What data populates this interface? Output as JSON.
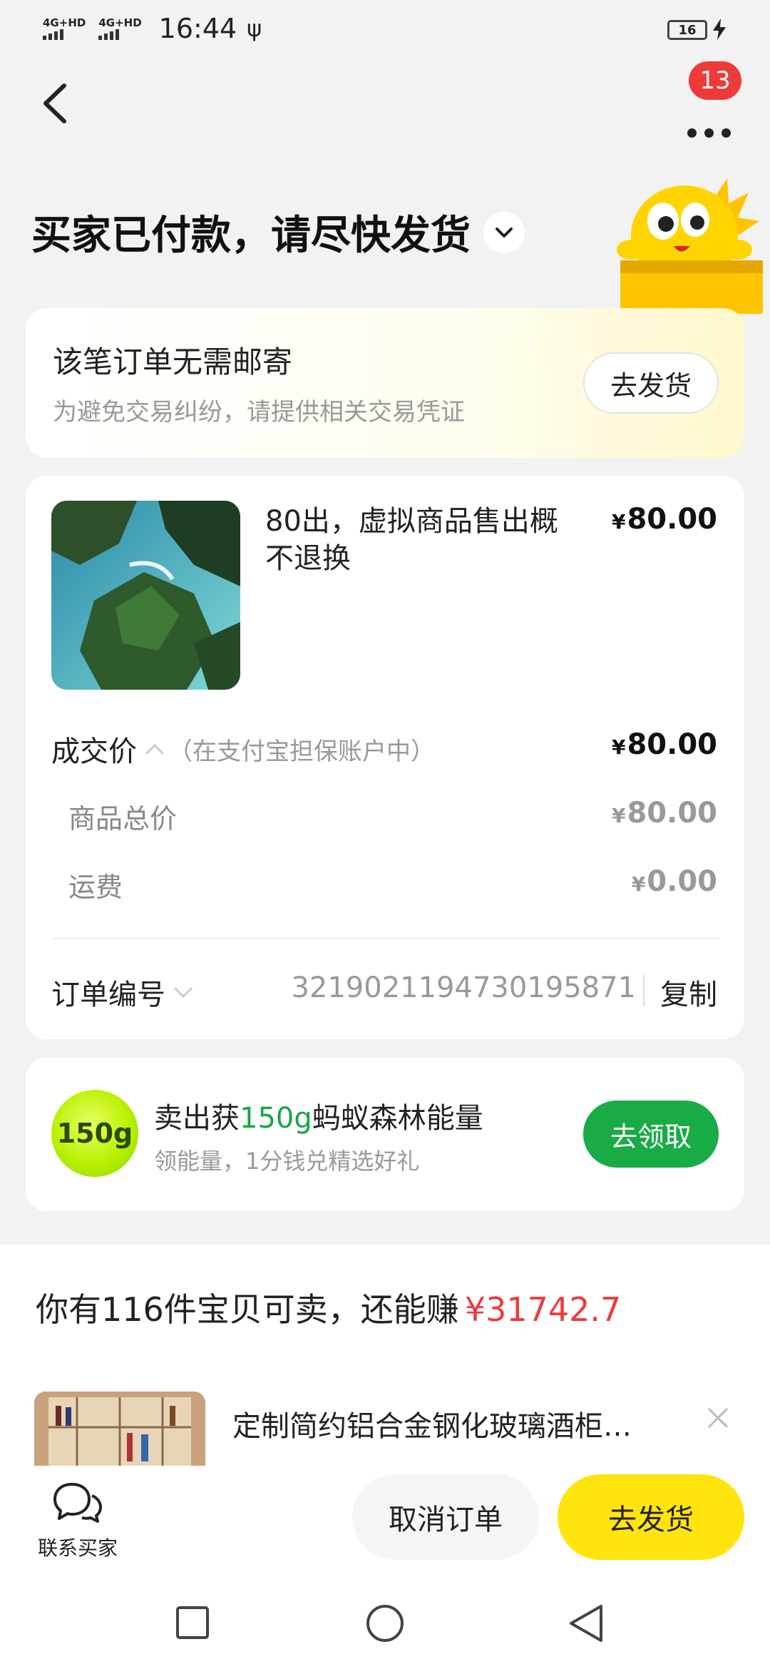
{
  "status_bar": {
    "signal1": "4G+HD",
    "signal2": "4G+HD",
    "time": "16:44",
    "battery": "16"
  },
  "nav": {
    "badge_count": "13"
  },
  "header": {
    "title": "买家已付款，请尽快发货"
  },
  "shipping_notice": {
    "title": "该笔订单无需邮寄",
    "subtitle": "为避免交易纠纷，请提供相关交易凭证",
    "button": "去发货"
  },
  "order": {
    "product_title": "80出，虚拟商品售出概不退换",
    "product_price_symbol": "¥",
    "product_price": "80.00",
    "deal_price_label": "成交价",
    "deal_price_note": "（在支付宝担保账户中）",
    "deal_price": "80.00",
    "goods_total_label": "商品总价",
    "goods_total": "80.00",
    "shipping_label": "运费",
    "shipping": "0.00",
    "order_no_label": "订单编号",
    "order_no": "3219021194730195871",
    "copy_label": "复制"
  },
  "energy": {
    "badge": "150g",
    "title_pre": "卖出获",
    "title_highlight": "150g",
    "title_post": "蚂蚁森林能量",
    "subtitle": "领能量，1分钱兑精选好礼",
    "button": "去领取"
  },
  "promo": {
    "text": "你有116件宝贝可卖，还能赚",
    "amount": "¥31742.7"
  },
  "recommendation": {
    "title": "定制简约铝合金钢化玻璃酒柜…"
  },
  "bottom_bar": {
    "contact_label": "联系买家",
    "cancel_button": "取消订单",
    "ship_button": "去发货"
  },
  "colors": {
    "accent_yellow": "#ffe40d",
    "accent_green": "#18ab46",
    "price_red": "#ef3a3a",
    "badge_red": "#ef3a3a"
  },
  "icons": [
    "back-arrow-icon",
    "more-dots-icon",
    "chevron-down-icon",
    "chevron-up-icon",
    "chat-icon",
    "close-icon",
    "usb-icon",
    "bolt-icon",
    "square-nav-icon",
    "circle-nav-icon",
    "triangle-back-icon"
  ]
}
